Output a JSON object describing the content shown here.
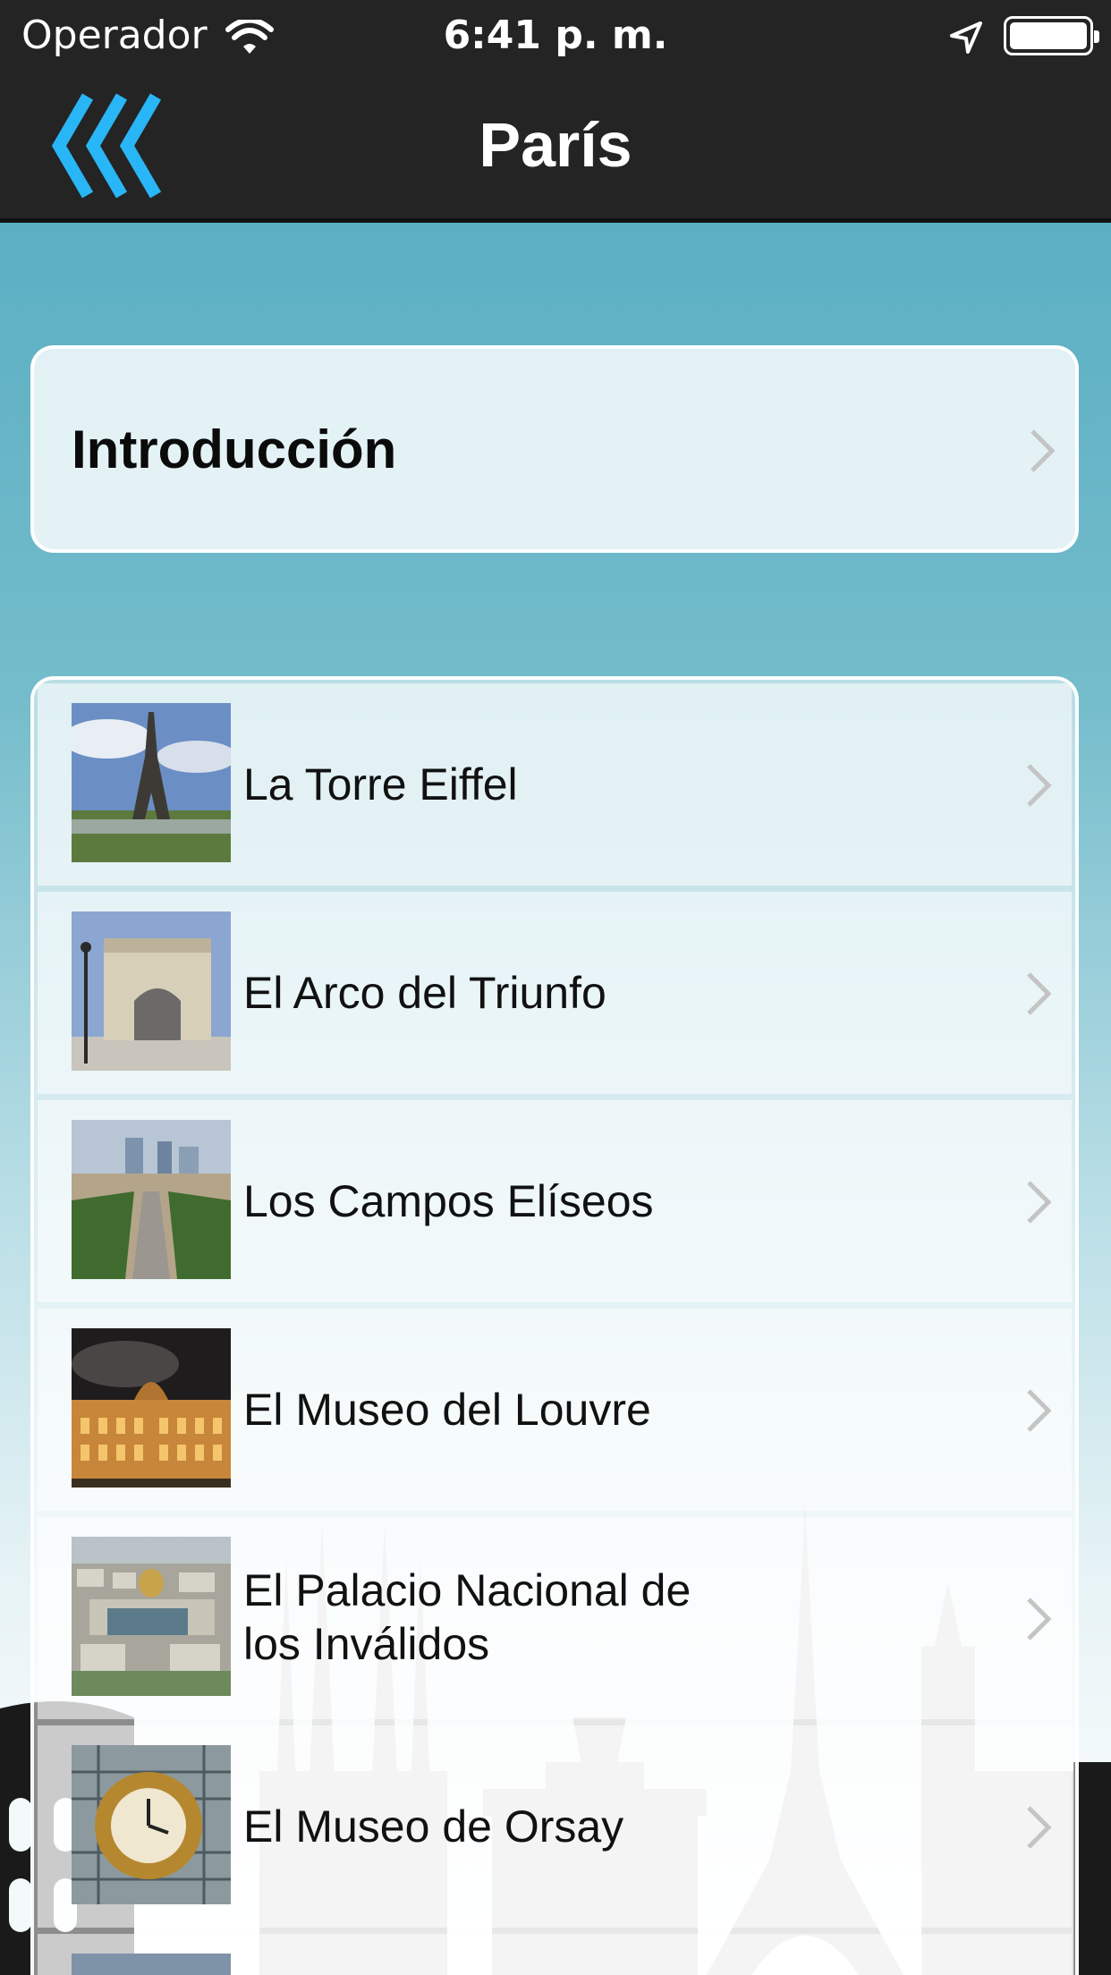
{
  "status_bar": {
    "carrier": "Operador",
    "time": "6:41 p. m."
  },
  "nav": {
    "title": "París"
  },
  "intro": {
    "label": "Introducción"
  },
  "list": {
    "items": [
      {
        "label": "La Torre Eiffel",
        "thumb": "eiffel-tower"
      },
      {
        "label": "El Arco del Triunfo",
        "thumb": "arc-de-triomphe"
      },
      {
        "label": "Los Campos Elíseos",
        "thumb": "champs-elysees"
      },
      {
        "label": "El Museo del Louvre",
        "thumb": "louvre"
      },
      {
        "label": "El Palacio Nacional de los Inválidos",
        "thumb": "invalides"
      },
      {
        "label": "El Museo de Orsay",
        "thumb": "orsay-clock"
      }
    ]
  },
  "colors": {
    "bar_bg": "#242424",
    "accent_back": "#29b6f6",
    "skyline": "#c8c8c8"
  }
}
